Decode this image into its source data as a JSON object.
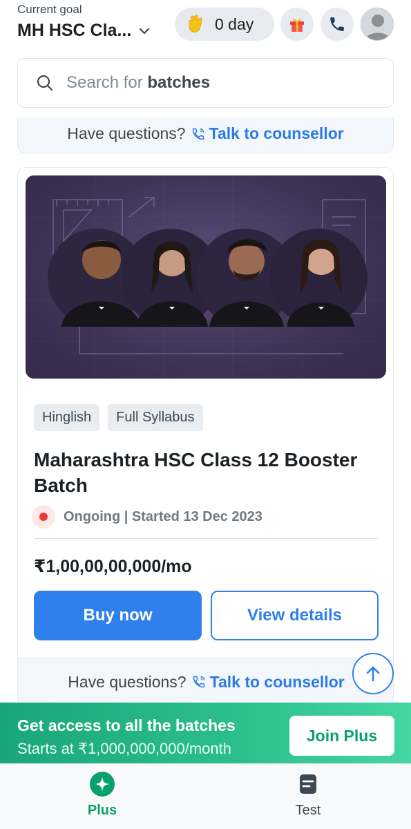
{
  "header": {
    "goal_caption": "Current goal",
    "goal_title": "MH HSC Cla...",
    "streak_label": "0 day",
    "icons": [
      "clap-icon",
      "gift-icon",
      "phone-icon",
      "avatar"
    ]
  },
  "search": {
    "prefix": "Search for ",
    "keyword": "batches"
  },
  "counsellor": {
    "question": "Have questions?",
    "link": "Talk to counsellor"
  },
  "batch_card": {
    "tags": [
      "Hinglish",
      "Full Syllabus"
    ],
    "title": "Maharashtra HSC Class 12 Booster Batch",
    "status": "Ongoing | Started 13 Dec 2023",
    "price": "₹1,00,00,00,000/mo",
    "buy_label": "Buy now",
    "view_label": "View details"
  },
  "plus_banner": {
    "title": "Get access to all the batches",
    "subtitle": "Starts at ₹1,000,000,000/month",
    "cta": "Join Plus"
  },
  "bottom_nav": {
    "items": [
      {
        "label": "Plus",
        "active": true
      },
      {
        "label": "Test",
        "active": false
      }
    ]
  },
  "colors": {
    "primary_blue": "#2f80ed",
    "plus_green": "#08a06c",
    "status_red": "#eb3737",
    "banner_purple": "#3f3356"
  }
}
